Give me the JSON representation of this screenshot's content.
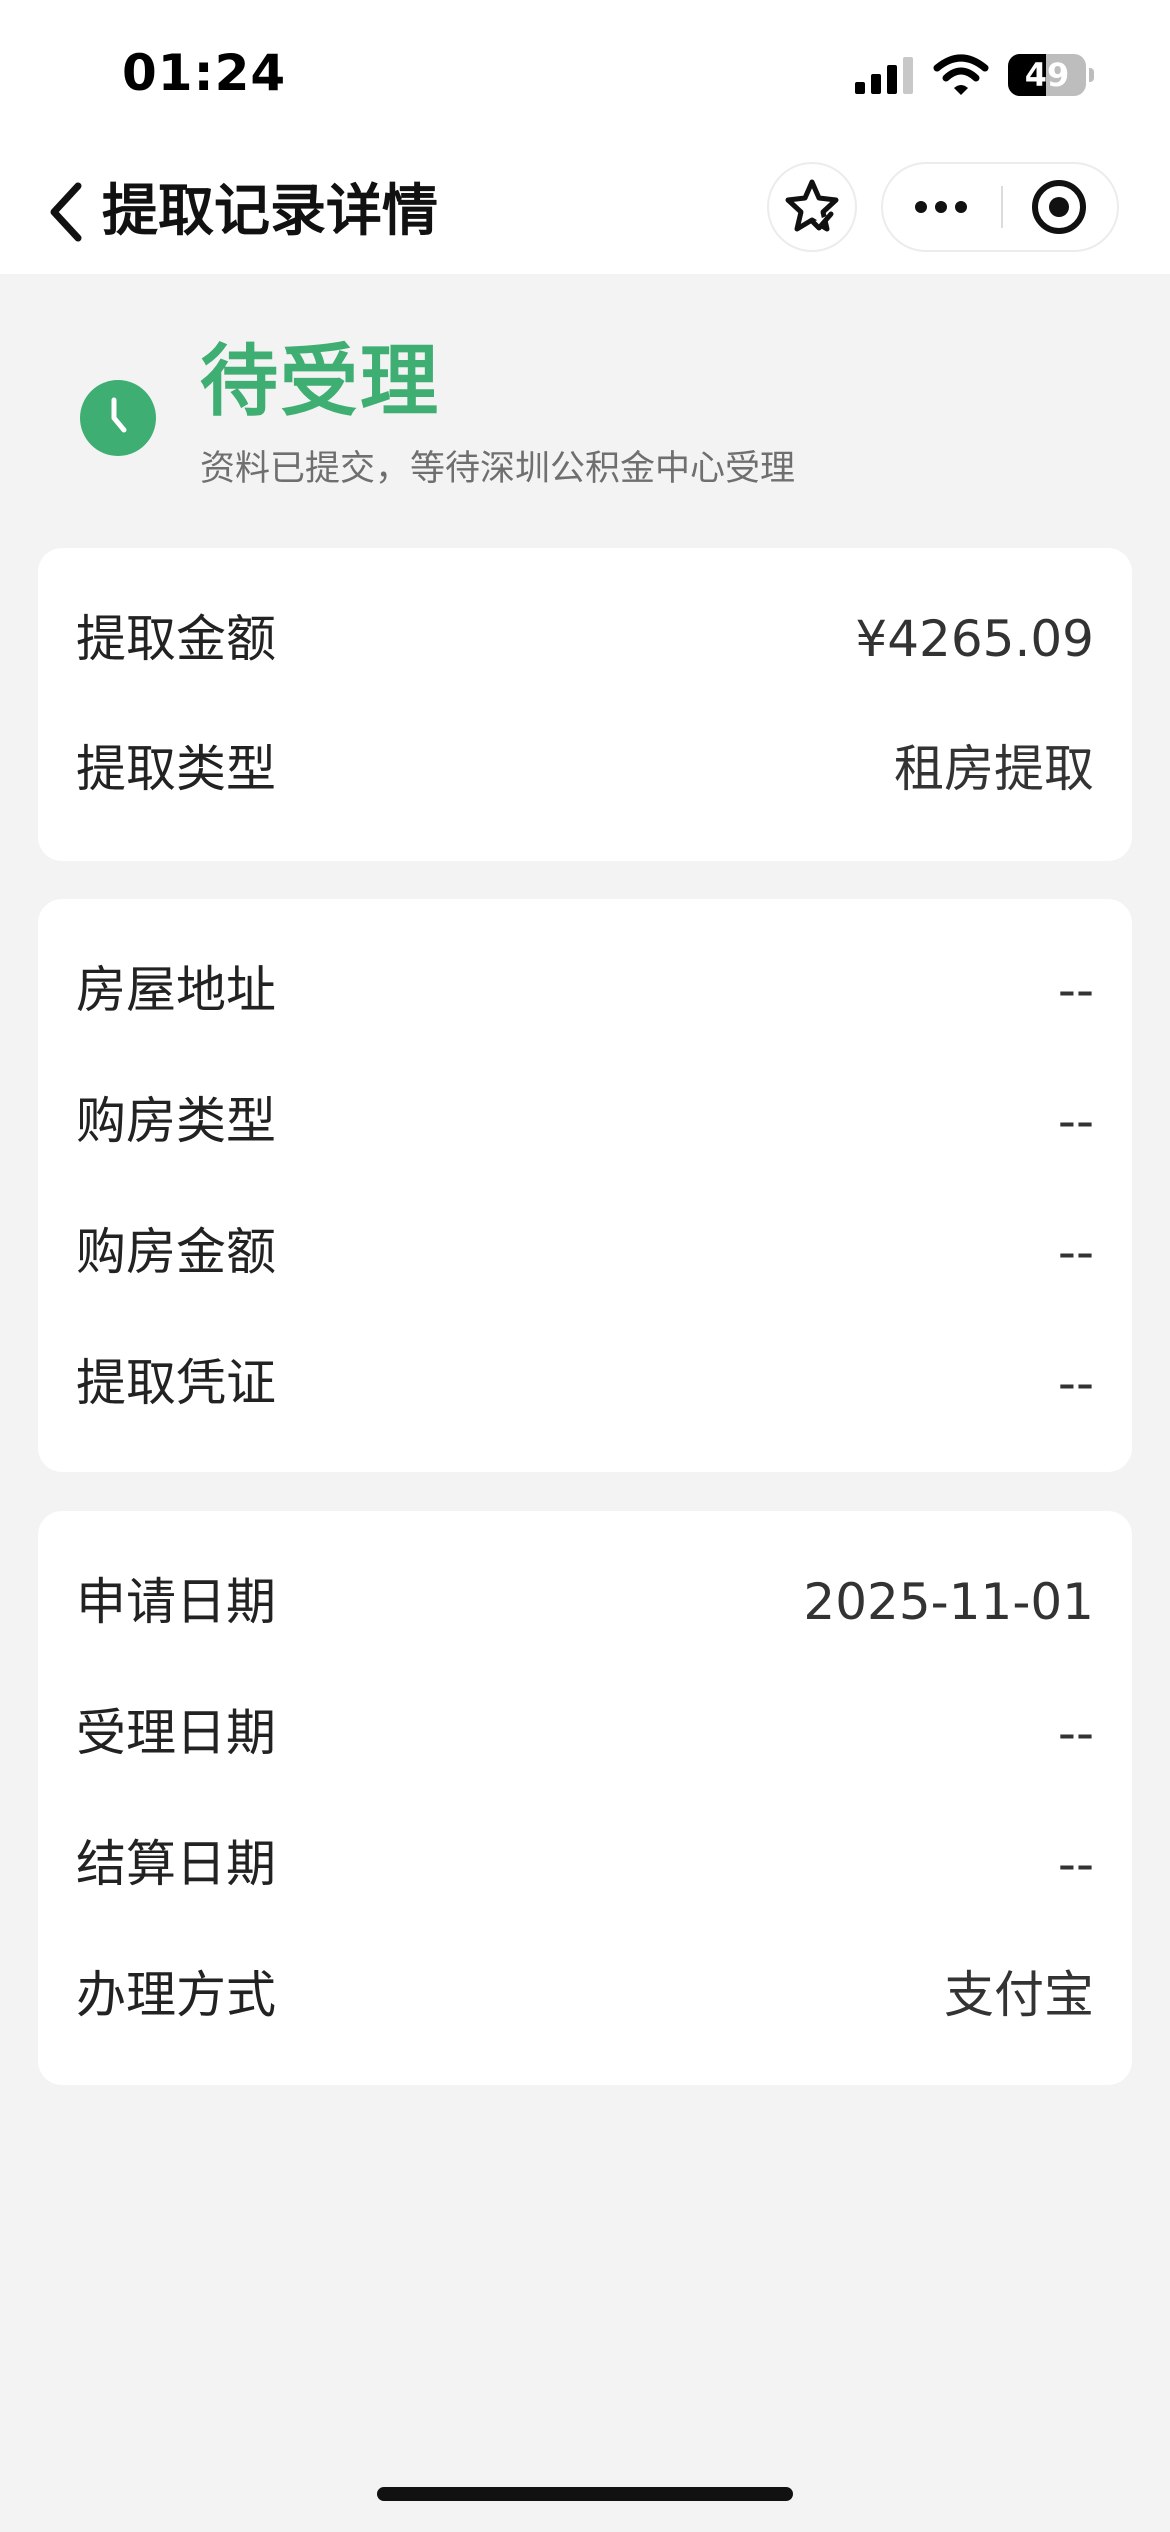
{
  "status_bar": {
    "time": "01:24",
    "battery_level": "49",
    "battery_fraction": 0.49
  },
  "nav": {
    "title": "提取记录详情",
    "icons": [
      "chevron-left-icon",
      "star-check-icon",
      "more-dots-icon",
      "close-target-icon"
    ]
  },
  "status": {
    "title": "待受理",
    "description": "资料已提交，等待深圳公积金中心受理",
    "icon": "clock-icon",
    "accent_color": "#3fae72"
  },
  "cards": [
    {
      "rows": [
        {
          "label": "提取金额",
          "value": "¥4265.09"
        },
        {
          "label": "提取类型",
          "value": "租房提取"
        }
      ]
    },
    {
      "rows": [
        {
          "label": "房屋地址",
          "value": "--"
        },
        {
          "label": "购房类型",
          "value": "--"
        },
        {
          "label": "购房金额",
          "value": "--"
        },
        {
          "label": "提取凭证",
          "value": "--"
        }
      ]
    },
    {
      "rows": [
        {
          "label": "申请日期",
          "value": "2025-11-01"
        },
        {
          "label": "受理日期",
          "value": "--"
        },
        {
          "label": "结算日期",
          "value": "--"
        },
        {
          "label": "办理方式",
          "value": "支付宝"
        }
      ]
    }
  ]
}
